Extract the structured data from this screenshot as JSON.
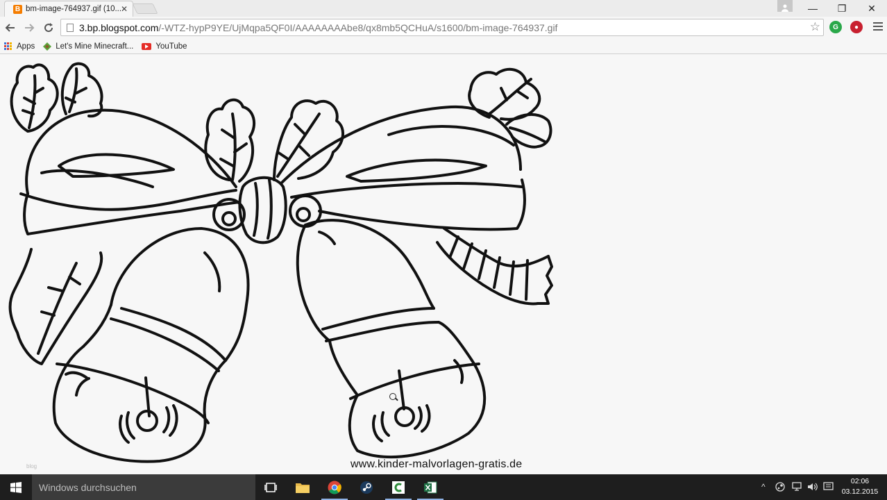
{
  "browser": {
    "tab": {
      "title": "bm-image-764937.gif (10...",
      "favicon_letter": "B"
    },
    "window_controls": {
      "minimize": "—",
      "restore": "❐",
      "close": "✕"
    },
    "address": {
      "host": "3.bp.blogspot.com",
      "path": "/-WTZ-hypP9YE/UjMqpa5QF0I/AAAAAAAAbe8/qx8mb5QCHuA/s1600/bm-image-764937.gif"
    },
    "bookmarks": [
      {
        "label": "Apps",
        "icon": "apps-grid-icon"
      },
      {
        "label": "Let's Mine Minecraft...",
        "icon": "minecraft-icon"
      },
      {
        "label": "YouTube",
        "icon": "youtube-icon"
      }
    ]
  },
  "content": {
    "image_caption": "www.kinder-malvorlagen-gratis.de",
    "corner_mark": "blog"
  },
  "taskbar": {
    "search_placeholder": "Windows durchsuchen",
    "apps": [
      "task-view-icon",
      "file-explorer-icon",
      "chrome-icon",
      "steam-icon",
      "camtasia-icon",
      "excel-icon"
    ],
    "clock": {
      "time": "02:06",
      "date": "03.12.2015"
    }
  },
  "colors": {
    "taskbar": "#1e1e1e",
    "search_box": "#3b3b3b",
    "tab_favicon": "#f57d00",
    "youtube": "#e52d27"
  }
}
